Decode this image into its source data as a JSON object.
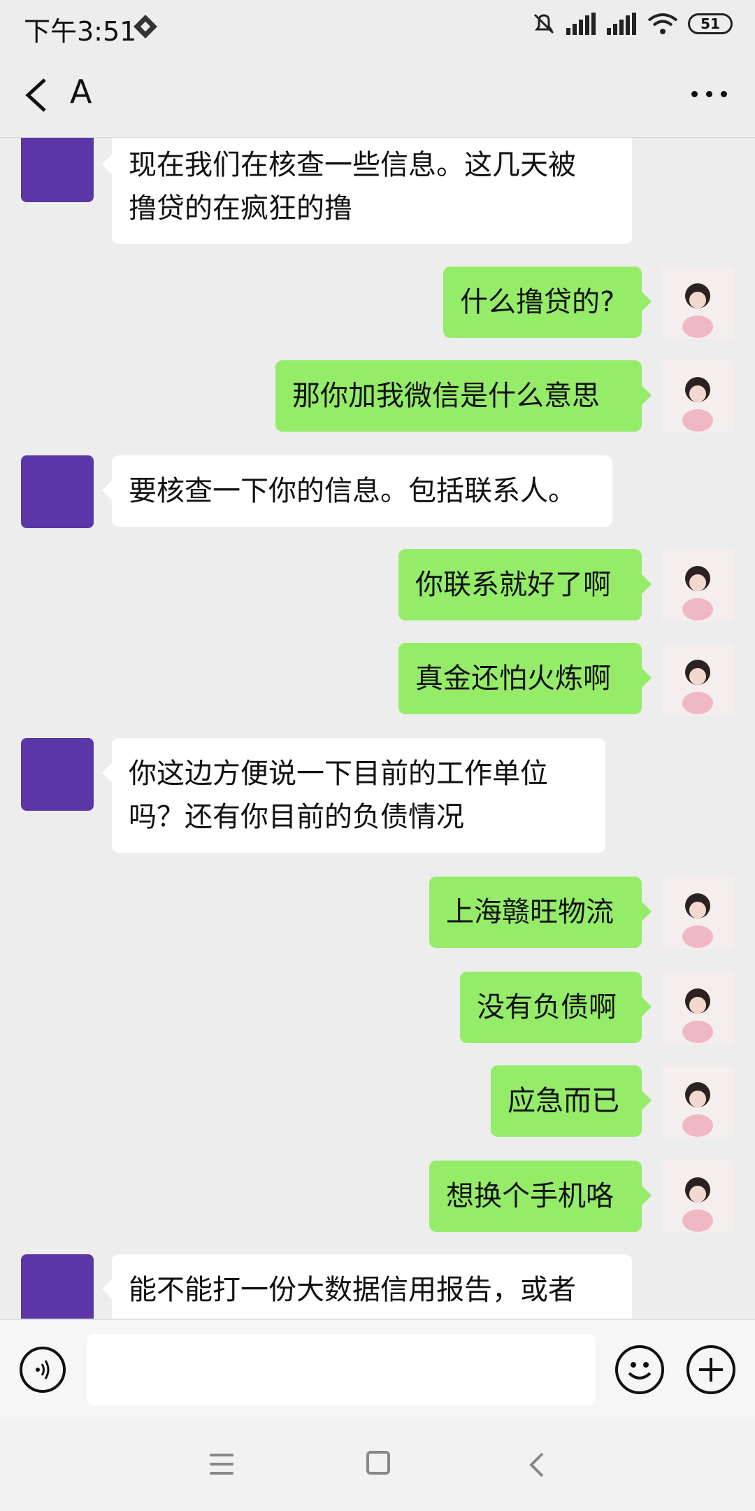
{
  "status": {
    "time": "下午3:51",
    "battery": "51"
  },
  "header": {
    "title": "A"
  },
  "messages": [
    {
      "side": "in",
      "lines": [
        "现在我们在核查一些信息。这几天被",
        "撸贷的在疯狂的撸"
      ]
    },
    {
      "side": "out",
      "lines": [
        "什么撸贷的?"
      ]
    },
    {
      "side": "out",
      "lines": [
        "那你加我微信是什么意思"
      ]
    },
    {
      "side": "in",
      "lines": [
        "要核查一下你的信息。包括联系人。"
      ]
    },
    {
      "side": "out",
      "lines": [
        "你联系就好了啊"
      ]
    },
    {
      "side": "out",
      "lines": [
        "真金还怕火炼啊"
      ]
    },
    {
      "side": "in",
      "lines": [
        "你这边方便说一下目前的工作单位",
        "吗？还有你目前的负债情况"
      ]
    },
    {
      "side": "out",
      "lines": [
        "上海赣旺物流"
      ]
    },
    {
      "side": "out",
      "lines": [
        "没有负债啊"
      ]
    },
    {
      "side": "out",
      "lines": [
        "应急而已"
      ]
    },
    {
      "side": "out",
      "lines": [
        "想换个手机咯"
      ]
    },
    {
      "side": "in",
      "lines": [
        "能不能打一份大数据信用报告，或者"
      ]
    }
  ],
  "icons": {
    "back": "back-arrow-icon",
    "more": "more-icon",
    "voice": "voice-icon",
    "emoji": "emoji-icon",
    "plus": "plus-icon"
  },
  "colors": {
    "out_bubble": "#95ec69",
    "in_bubble": "#ffffff",
    "avatar_left": "#5a36a6"
  }
}
